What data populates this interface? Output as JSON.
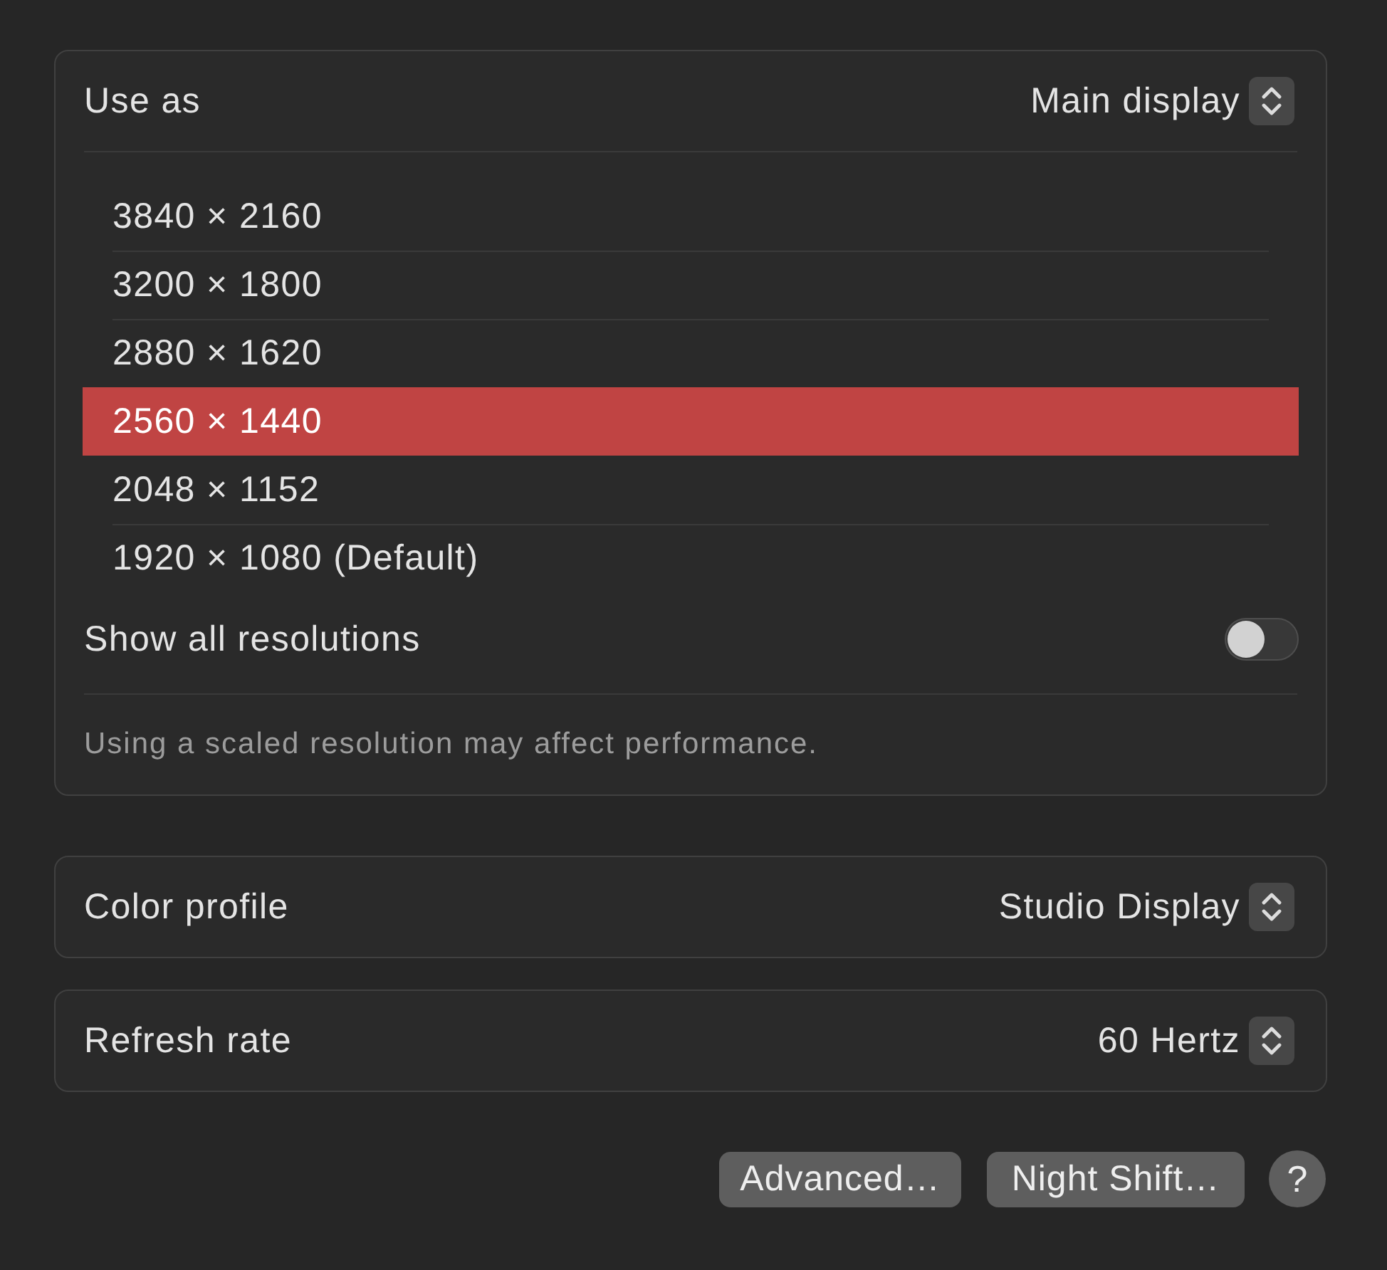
{
  "display": {
    "use_as": {
      "label": "Use as",
      "value": "Main display"
    },
    "resolutions": [
      {
        "label": "3840 × 2160",
        "selected": false
      },
      {
        "label": "3200 × 1800",
        "selected": false
      },
      {
        "label": "2880 × 1620",
        "selected": false
      },
      {
        "label": "2560 × 1440",
        "selected": true
      },
      {
        "label": "2048 × 1152",
        "selected": false
      },
      {
        "label": "1920 × 1080 (Default)",
        "selected": false
      }
    ],
    "show_all": {
      "label": "Show all resolutions",
      "on": false
    },
    "note": "Using a scaled resolution may affect performance."
  },
  "color_profile": {
    "label": "Color profile",
    "value": "Studio Display"
  },
  "refresh_rate": {
    "label": "Refresh rate",
    "value": "60 Hertz"
  },
  "buttons": [
    {
      "label": "Advanced…"
    },
    {
      "label": "Night Shift…"
    }
  ],
  "help": "?"
}
